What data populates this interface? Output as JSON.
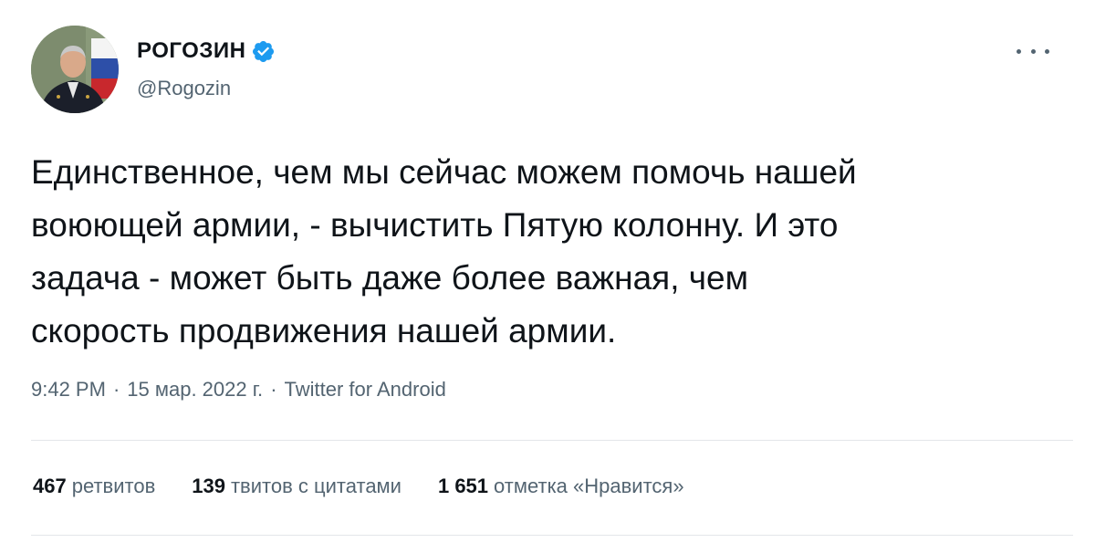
{
  "author": {
    "name": "РОГОЗИН",
    "handle": "@Rogozin",
    "verified_color": "#1d9bf0"
  },
  "tweet": {
    "text": "Единственное, чем мы сейчас можем помочь нашей\nвоюющей армии, - вычистить Пятую колонну. И это\nзадача - может быть даже более важная, чем\nскорость продвижения нашей армии.",
    "time": "9:42 PM",
    "separator": "·",
    "date": "15 мар. 2022 г.",
    "client": "Twitter for Android"
  },
  "stats": {
    "retweets": {
      "count": "467",
      "label": "ретвитов"
    },
    "quotes": {
      "count": "139",
      "label": "твитов с цитатами"
    },
    "likes": {
      "count": "1 651",
      "label": "отметка «Нравится»"
    }
  },
  "icons": {
    "verified": "verified-badge-icon",
    "more": "more-options-icon"
  }
}
